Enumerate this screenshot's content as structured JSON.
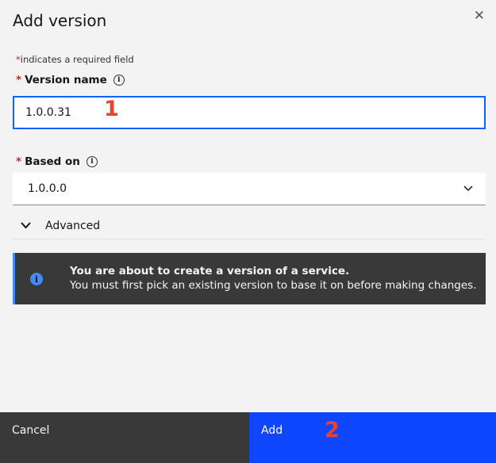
{
  "modal": {
    "title": "Add version",
    "close_icon": "close-icon"
  },
  "form": {
    "required_star": "*",
    "required_note": "indicates a required field",
    "version_name": {
      "label": "Version name",
      "info_icon": "i",
      "value": "1.0.0.31",
      "annotation": "1"
    },
    "based_on": {
      "label": "Based on",
      "info_icon": "i",
      "value": "1.0.0.0",
      "chevron": "⌄"
    },
    "advanced": {
      "chevron": "⌄",
      "label": "Advanced"
    }
  },
  "notice": {
    "icon": "i",
    "title": "You are about to create a version of a service.",
    "body": "You must first pick an existing version to base it on before making changes."
  },
  "footer": {
    "cancel_label": "Cancel",
    "add_label": "Add",
    "add_annotation": "2"
  },
  "colors": {
    "accent": "#0f62fe",
    "add_button": "#0f46ff",
    "required": "#da1e28",
    "annotation": "#e8432e",
    "notice_bg": "#393939"
  }
}
